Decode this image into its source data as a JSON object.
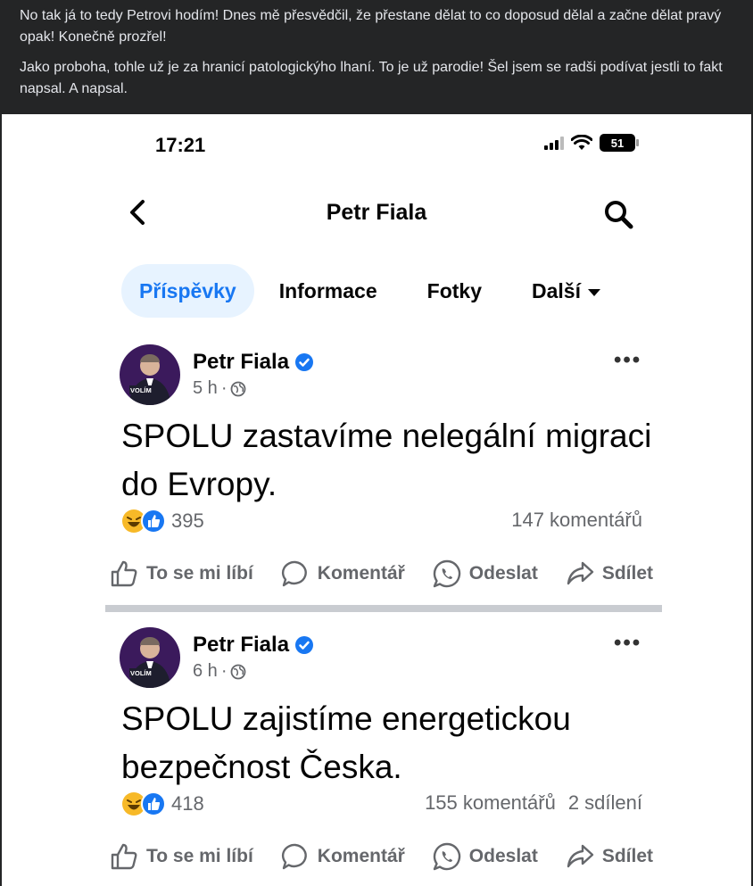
{
  "fb_post": {
    "paragraph1": "No tak já to tedy Petrovi hodím! Dnes mě přesvědčil, že přestane dělat to co doposud dělal a začne dělat pravý opak! Konečně prozřel!",
    "paragraph2": "Jako proboha, tohle už je za hranicí patologickýho lhaní. To je už parodie! Šel jsem se radši podívat jestli to fakt napsal. A napsal."
  },
  "phone": {
    "time": "17:21",
    "battery": "51",
    "page_title": "Petr Fiala",
    "tabs": [
      "Příspěvky",
      "Informace",
      "Fotky",
      "Další"
    ],
    "active_tab": "Příspěvky"
  },
  "avatar_label": "VOLÍM",
  "posts": [
    {
      "author": "Petr Fiala",
      "time": "5 h",
      "text": "SPOLU zastavíme nelegální migraci do Evropy.",
      "reactions": "395",
      "comments": "147 komentářů",
      "shares": ""
    },
    {
      "author": "Petr Fiala",
      "time": "6 h",
      "text": "SPOLU zajistíme energetickou bezpečnost Česka.",
      "reactions": "418",
      "comments": "155 komentářů",
      "shares": "2 sdílení"
    }
  ],
  "actions": {
    "like": "To se mi líbí",
    "comment": "Komentář",
    "send": "Odeslat",
    "share": "Sdílet"
  },
  "colors": {
    "fb_blue": "#1877f2",
    "dark_bg": "#242526",
    "muted": "#65676b"
  },
  "icons": [
    "back-arrow-icon",
    "search-icon",
    "verified-icon",
    "globe-icon",
    "more-icon",
    "haha-icon",
    "like-icon",
    "comment-icon",
    "whatsapp-icon",
    "share-icon"
  ]
}
